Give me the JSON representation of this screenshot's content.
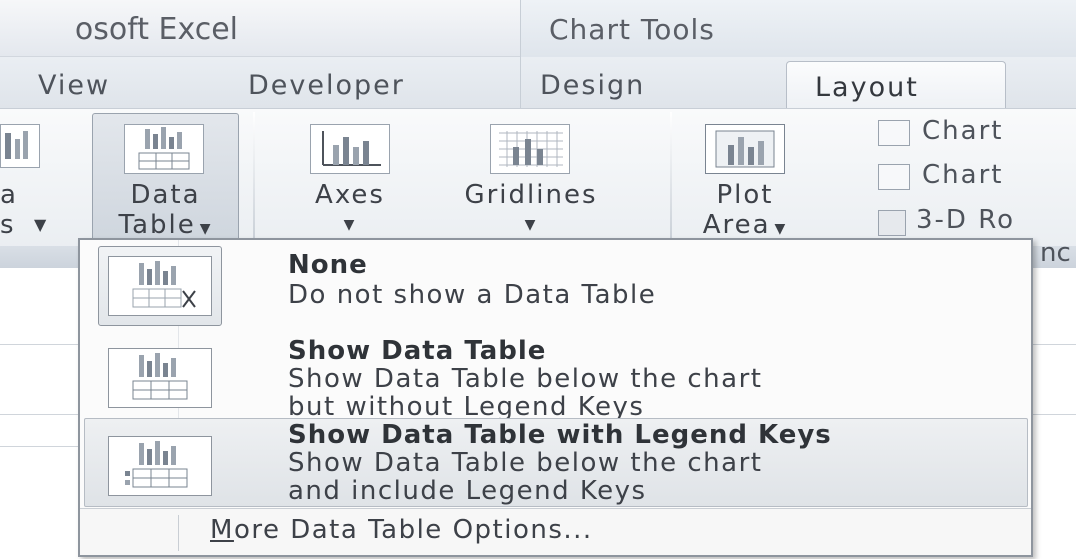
{
  "window": {
    "title_fragment": "osoft Excel"
  },
  "context_tab_group": {
    "title": "Chart Tools"
  },
  "tabs": {
    "view": "View",
    "developer": "Developer",
    "design": "Design",
    "layout": "Layout"
  },
  "ribbon": {
    "partial_left_top": "a",
    "partial_left_bottom": "s",
    "data_table": {
      "line1": "Data",
      "line2": "Table"
    },
    "axes": {
      "label": "Axes"
    },
    "gridlines": {
      "label": "Gridlines"
    },
    "plot_area": {
      "line1": "Plot",
      "line2": "Area"
    },
    "chart_wall": "Chart",
    "chart_floor": "Chart",
    "rotation": "3-D Ro",
    "group_label_fragment": "nc"
  },
  "menu": {
    "items": [
      {
        "title": "None",
        "desc": [
          "Do not show a Data Table"
        ],
        "icon": "data-table-none-icon"
      },
      {
        "title": "Show Data Table",
        "desc": [
          "Show Data Table below the chart",
          "but without Legend Keys"
        ],
        "icon": "data-table-show-icon"
      },
      {
        "title": "Show Data Table with Legend Keys",
        "desc": [
          "Show Data Table below the chart",
          "and include Legend Keys"
        ],
        "icon": "data-table-legend-keys-icon"
      }
    ],
    "more_options": {
      "mnemonic": "M",
      "rest": "ore Data Table Options..."
    }
  },
  "colors": {
    "accent_border": "#8e959e",
    "ribbon_bg": "#e9edf1",
    "hover_bg": "#dfe3e7"
  }
}
